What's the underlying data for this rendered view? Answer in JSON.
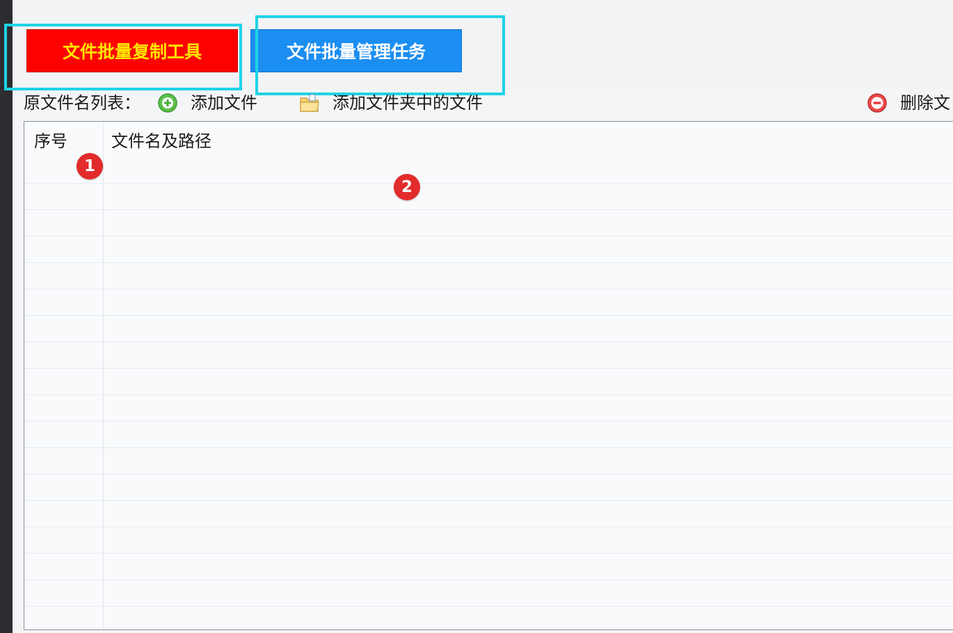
{
  "tabs": {
    "copy_tool_label": "文件批量复制工具",
    "manage_task_label": "文件批量管理任务"
  },
  "toolbar": {
    "list_label": "原文件名列表：",
    "add_file_label": "添加文件",
    "add_folder_label": "添加文件夹中的文件",
    "delete_label": "删除文"
  },
  "table": {
    "columns": [
      "序号",
      "文件名及路径"
    ],
    "rows": []
  },
  "markers": [
    "1",
    "2"
  ],
  "icons": {
    "add_file": "plus-circle-icon",
    "add_folder": "folder-icon",
    "delete": "minus-circle-icon"
  },
  "colors": {
    "copy_button_bg": "#fd0101",
    "copy_button_text": "#ffe600",
    "manage_button_bg": "#1b8ef2",
    "highlight": "#1fd3e5",
    "marker": "#e22b2b"
  }
}
